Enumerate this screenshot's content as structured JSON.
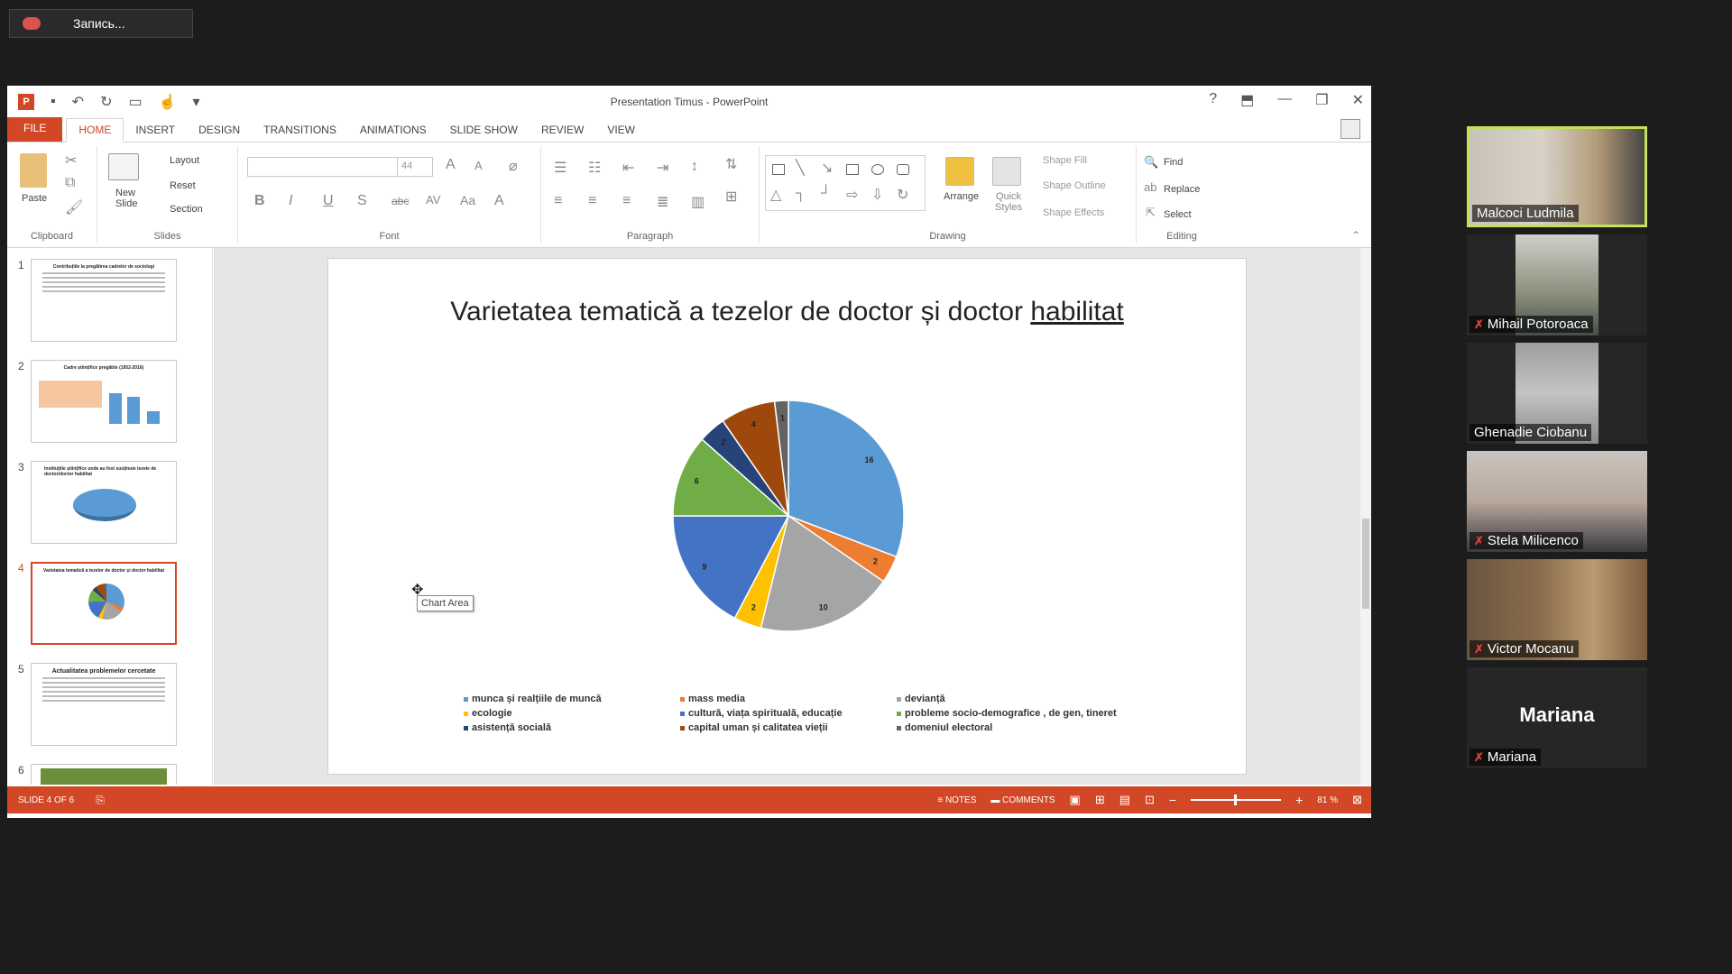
{
  "recording": {
    "label": "Запись..."
  },
  "window": {
    "title": "Presentation Timus - PowerPoint"
  },
  "tabs": [
    "FILE",
    "HOME",
    "INSERT",
    "DESIGN",
    "TRANSITIONS",
    "ANIMATIONS",
    "SLIDE SHOW",
    "REVIEW",
    "VIEW"
  ],
  "ribbon": {
    "clipboard": {
      "paste": "Paste",
      "label": "Clipboard"
    },
    "slides": {
      "new_slide": "New Slide",
      "layout": "Layout",
      "reset": "Reset",
      "section": "Section",
      "label": "Slides"
    },
    "font": {
      "size": "44",
      "label": "Font"
    },
    "paragraph": {
      "label": "Paragraph"
    },
    "drawing": {
      "arrange": "Arrange",
      "quick_styles": "Quick Styles",
      "shape_fill": "Shape Fill",
      "shape_outline": "Shape Outline",
      "shape_effects": "Shape Effects",
      "label": "Drawing"
    },
    "editing": {
      "find": "Find",
      "replace": "Replace",
      "select": "Select",
      "label": "Editing"
    }
  },
  "thumbnails": [
    {
      "num": "1",
      "title": "Contribuțiile la pregătirea cadrelor de sociologi"
    },
    {
      "num": "2",
      "title": "Cadre științifice pregătite (1952-2016)"
    },
    {
      "num": "3",
      "title": "Instituțiile științifice unde au fost susținute tezele de doctor/doctor habilitat"
    },
    {
      "num": "4",
      "title": "Varietatea tematică a tezelor de doctor și doctor habilitat"
    },
    {
      "num": "5",
      "title": "Actualitatea problemelor cercetate"
    },
    {
      "num": "6",
      "title": ""
    }
  ],
  "slide": {
    "title_main": "Varietatea tematică a  tezelor de doctor și doctor ",
    "title_underlined": "habilitat",
    "tooltip": "Chart Area"
  },
  "chart_data": {
    "type": "pie",
    "series": [
      {
        "name": "munca și realțiile de muncă",
        "value": 16,
        "color": "#5b9bd5"
      },
      {
        "name": "mass media",
        "value": 2,
        "color": "#ed7d31"
      },
      {
        "name": "devianță",
        "value": 10,
        "color": "#a5a5a5"
      },
      {
        "name": "ecologie",
        "value": 2,
        "color": "#ffc000"
      },
      {
        "name": "cultură, viața spirituală, educație",
        "value": 9,
        "color": "#4472c4"
      },
      {
        "name": "probleme socio-demografice , de gen, tineret",
        "value": 6,
        "color": "#70ad47"
      },
      {
        "name": "asistență socială",
        "value": 2,
        "color": "#264478"
      },
      {
        "name": "capital uman și calitatea vieții",
        "value": 4,
        "color": "#9e480e"
      },
      {
        "name": "domeniul electoral",
        "value": 1,
        "color": "#636363"
      }
    ],
    "legend_order": [
      0,
      1,
      2,
      3,
      4,
      5,
      6,
      7,
      8
    ],
    "legend_position": "bottom"
  },
  "status": {
    "slide": "SLIDE 4 OF 6",
    "notes": "NOTES",
    "comments": "COMMENTS",
    "zoom": "81 %"
  },
  "participants": [
    {
      "name": "Malcoci Ludmila",
      "muted": false,
      "active": true
    },
    {
      "name": "Mihail Potoroaca",
      "muted": true,
      "active": false
    },
    {
      "name": "Ghenadie Ciobanu",
      "muted": false,
      "active": false
    },
    {
      "name": "Stela Milicenco",
      "muted": true,
      "active": false
    },
    {
      "name": "Victor  Mocanu",
      "muted": true,
      "active": false
    },
    {
      "name": "Mariana",
      "muted": true,
      "active": false,
      "avatar_text": "Mariana"
    }
  ]
}
